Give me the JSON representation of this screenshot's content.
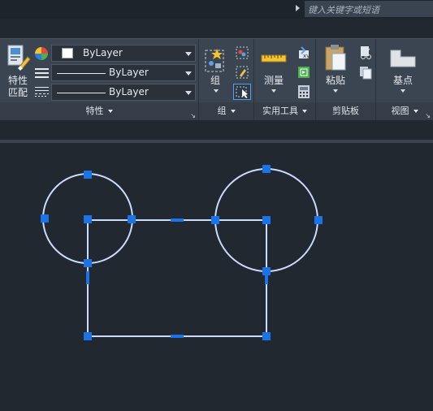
{
  "search": {
    "placeholder": "键入关键字或短语"
  },
  "panels": {
    "properties": {
      "match_label_line1": "特性",
      "match_label_line2": "匹配",
      "color_value": "ByLayer",
      "linetype_value": "ByLayer",
      "lineweight_value": "ByLayer",
      "title": "特性"
    },
    "groups": {
      "group_label": "组",
      "title": "组"
    },
    "utilities": {
      "measure_label": "测量",
      "title": "实用工具"
    },
    "clipboard": {
      "paste_label": "粘贴",
      "title": "剪贴板"
    },
    "view": {
      "basepoint_label": "基点",
      "title": "视图"
    }
  },
  "colors": {
    "background": "#212830",
    "ribbon": "#3b4451",
    "geometry": "#c9dcff",
    "grip": "#1a73e8"
  },
  "icons": [
    "match-properties-icon",
    "color-wheel-icon",
    "linetype-icon",
    "lineweight-icon",
    "group-icon",
    "ungroup-icon",
    "group-edit-icon",
    "group-select-icon",
    "measure-ruler-icon",
    "id-point-icon",
    "select-quick-icon",
    "calculator-icon",
    "paste-clipboard-icon",
    "cut-icon",
    "copy-icon",
    "basepoint-icon"
  ]
}
